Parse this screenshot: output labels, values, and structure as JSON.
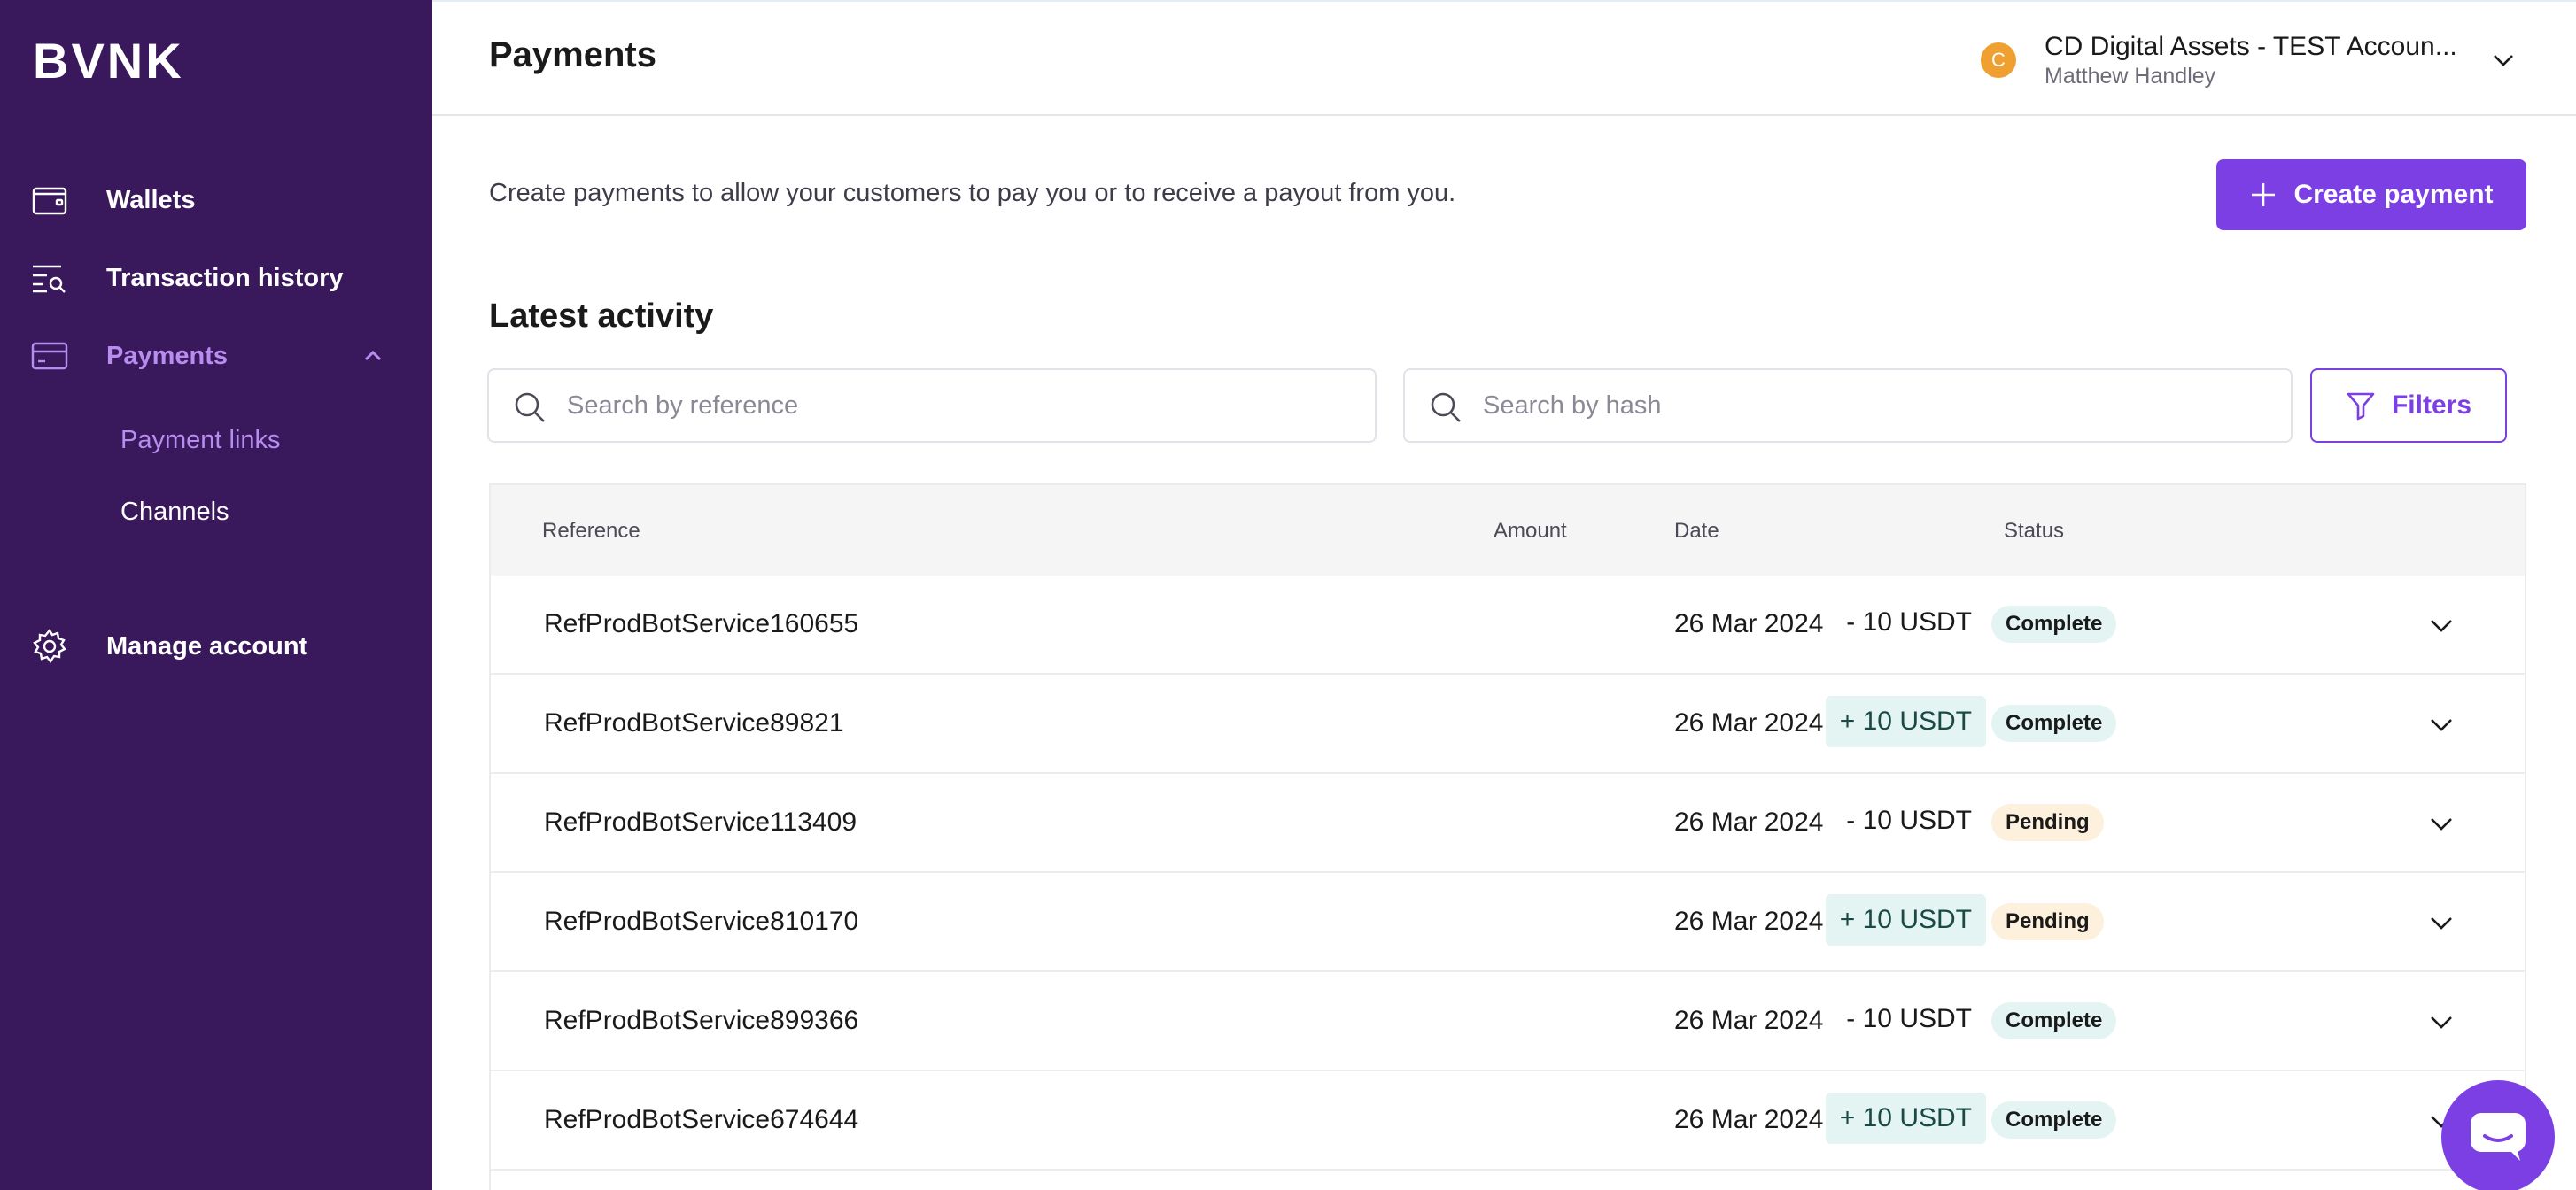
{
  "brand": {
    "logo_text": "BVNK",
    "accent": "#7b3fe4",
    "sidebar_bg": "#39195c"
  },
  "sidebar": {
    "items": [
      {
        "label": "Wallets",
        "icon": "wallet-icon"
      },
      {
        "label": "Transaction history",
        "icon": "search-list-icon"
      },
      {
        "label": "Payments",
        "icon": "card-icon",
        "expanded": true
      },
      {
        "label": "Manage account",
        "icon": "gear-icon"
      }
    ],
    "payments_sub": [
      {
        "label": "Payment links",
        "active": true
      },
      {
        "label": "Channels",
        "active": false
      }
    ]
  },
  "header": {
    "title": "Payments",
    "account": {
      "initial": "C",
      "name": "CD Digital Assets - TEST Accoun...",
      "user": "Matthew Handley"
    }
  },
  "main": {
    "intro": "Create payments to allow your customers to pay you or to receive a payout from you.",
    "create_button": "Create payment",
    "section_title": "Latest activity",
    "search_reference_placeholder": "Search by reference",
    "search_hash_placeholder": "Search by hash",
    "filters_button": "Filters"
  },
  "table": {
    "columns": {
      "reference": "Reference",
      "amount": "Amount",
      "date": "Date",
      "status": "Status"
    },
    "rows": [
      {
        "reference": "RefProdBotService160655",
        "amount": "- 10 USDT",
        "direction": "out",
        "date": "26 Mar 2024",
        "status": "Complete"
      },
      {
        "reference": "RefProdBotService89821",
        "amount": "+ 10 USDT",
        "direction": "in",
        "date": "26 Mar 2024",
        "status": "Complete"
      },
      {
        "reference": "RefProdBotService113409",
        "amount": "- 10 USDT",
        "direction": "out",
        "date": "26 Mar 2024",
        "status": "Pending"
      },
      {
        "reference": "RefProdBotService810170",
        "amount": "+ 10 USDT",
        "direction": "in",
        "date": "26 Mar 2024",
        "status": "Pending"
      },
      {
        "reference": "RefProdBotService899366",
        "amount": "- 10 USDT",
        "direction": "out",
        "date": "26 Mar 2024",
        "status": "Complete"
      },
      {
        "reference": "RefProdBotService674644",
        "amount": "+ 10 USDT",
        "direction": "in",
        "date": "26 Mar 2024",
        "status": "Complete"
      }
    ]
  }
}
